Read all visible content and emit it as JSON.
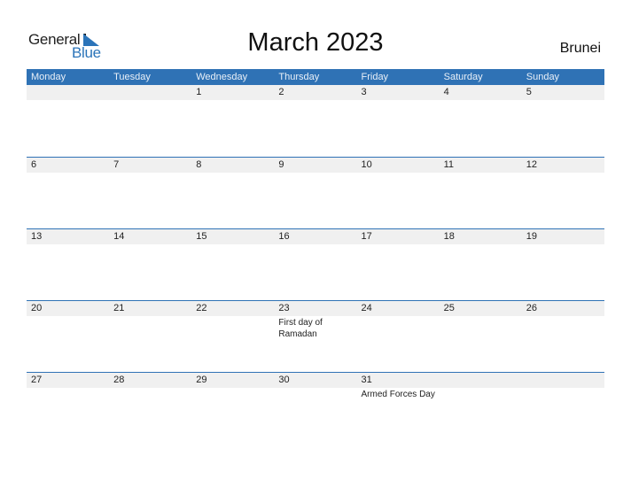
{
  "logo": {
    "general": "General",
    "blue": "Blue"
  },
  "title": "March 2023",
  "country": "Brunei",
  "colors": {
    "accent": "#2f72b5",
    "date_row_bg": "#f0f0f0"
  },
  "weekdays": [
    "Monday",
    "Tuesday",
    "Wednesday",
    "Thursday",
    "Friday",
    "Saturday",
    "Sunday"
  ],
  "weeks": [
    {
      "days": [
        "",
        "",
        "1",
        "2",
        "3",
        "4",
        "5"
      ],
      "events": [
        "",
        "",
        "",
        "",
        "",
        "",
        ""
      ]
    },
    {
      "days": [
        "6",
        "7",
        "8",
        "9",
        "10",
        "11",
        "12"
      ],
      "events": [
        "",
        "",
        "",
        "",
        "",
        "",
        ""
      ]
    },
    {
      "days": [
        "13",
        "14",
        "15",
        "16",
        "17",
        "18",
        "19"
      ],
      "events": [
        "",
        "",
        "",
        "",
        "",
        "",
        ""
      ]
    },
    {
      "days": [
        "20",
        "21",
        "22",
        "23",
        "24",
        "25",
        "26"
      ],
      "events": [
        "",
        "",
        "",
        "First day of Ramadan",
        "",
        "",
        ""
      ]
    },
    {
      "days": [
        "27",
        "28",
        "29",
        "30",
        "31",
        "",
        ""
      ],
      "events": [
        "",
        "",
        "",
        "",
        "Armed Forces Day",
        "",
        ""
      ]
    }
  ]
}
